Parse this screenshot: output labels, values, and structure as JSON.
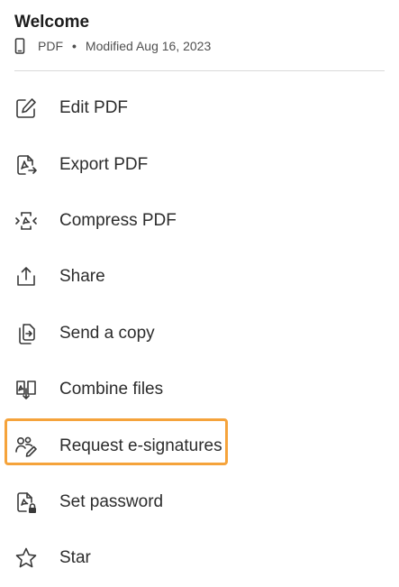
{
  "header": {
    "title": "Welcome",
    "type": "PDF",
    "separator": "•",
    "modified": "Modified Aug 16, 2023",
    "device_icon": "phone-icon"
  },
  "menu": {
    "items": [
      {
        "label": "Edit PDF",
        "icon": "edit-pdf-icon"
      },
      {
        "label": "Export PDF",
        "icon": "export-pdf-icon"
      },
      {
        "label": "Compress PDF",
        "icon": "compress-pdf-icon"
      },
      {
        "label": "Share",
        "icon": "share-icon"
      },
      {
        "label": "Send a copy",
        "icon": "send-copy-icon"
      },
      {
        "label": "Combine files",
        "icon": "combine-files-icon"
      },
      {
        "label": "Request e-signatures",
        "icon": "request-signatures-icon"
      },
      {
        "label": "Set password",
        "icon": "set-password-icon"
      },
      {
        "label": "Star",
        "icon": "star-icon"
      }
    ],
    "highlighted_item": "Request e-signatures"
  },
  "colors": {
    "highlight": "#f5a33b",
    "text": "#2c2c2c",
    "divider": "#dadada"
  }
}
